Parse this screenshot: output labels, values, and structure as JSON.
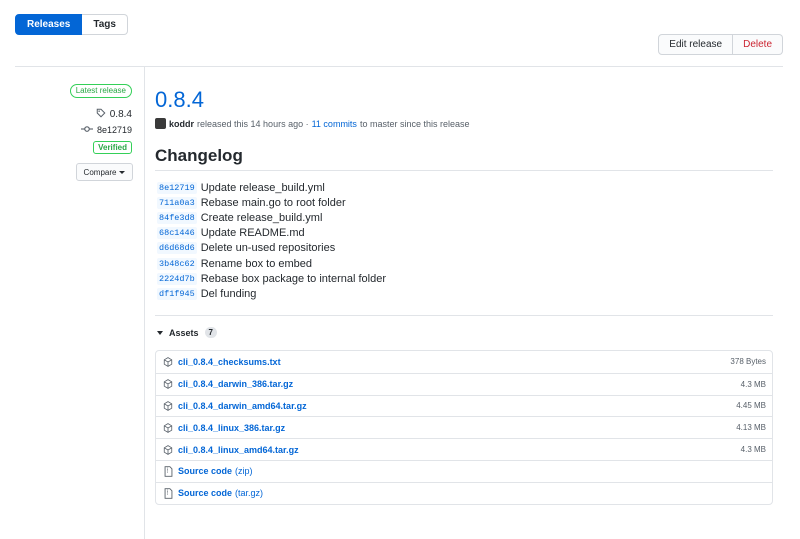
{
  "subnav": {
    "releases": "Releases",
    "tags": "Tags"
  },
  "actions": {
    "edit": "Edit release",
    "delete": "Delete"
  },
  "meta": {
    "latest": "Latest release",
    "tag": "0.8.4",
    "commit": "8e12719",
    "verified": "Verified",
    "compare": "Compare"
  },
  "release": {
    "version": "0.8.4",
    "author": "koddr",
    "released_text": "released this 14 hours ago ·",
    "commits_link": "11 commits",
    "since_text": "to master since this release"
  },
  "changelog": {
    "title": "Changelog",
    "commits": [
      {
        "sha": "8e12719",
        "msg": "Update release_build.yml"
      },
      {
        "sha": "711a0a3",
        "msg": "Rebase main.go to root folder"
      },
      {
        "sha": "84fe3d8",
        "msg": "Create release_build.yml"
      },
      {
        "sha": "68c1446",
        "msg": "Update README.md"
      },
      {
        "sha": "d6d68d6",
        "msg": "Delete un-used repositories"
      },
      {
        "sha": "3b48c62",
        "msg": "Rename box to embed"
      },
      {
        "sha": "2224d7b",
        "msg": "Rebase box package to internal folder"
      },
      {
        "sha": "df1f945",
        "msg": "Del funding"
      }
    ]
  },
  "assets": {
    "title": "Assets",
    "count": "7",
    "files": [
      {
        "name": "cli_0.8.4_checksums.txt",
        "size": "378 Bytes",
        "icon": "package-icon"
      },
      {
        "name": "cli_0.8.4_darwin_386.tar.gz",
        "size": "4.3 MB",
        "icon": "package-icon"
      },
      {
        "name": "cli_0.8.4_darwin_amd64.tar.gz",
        "size": "4.45 MB",
        "icon": "package-icon"
      },
      {
        "name": "cli_0.8.4_linux_386.tar.gz",
        "size": "4.13 MB",
        "icon": "package-icon"
      },
      {
        "name": "cli_0.8.4_linux_amd64.tar.gz",
        "size": "4.3 MB",
        "icon": "package-icon"
      }
    ],
    "source": [
      {
        "name": "Source code",
        "suffix": "(zip)",
        "icon": "file-zip-icon"
      },
      {
        "name": "Source code",
        "suffix": "(tar.gz)",
        "icon": "file-zip-icon"
      }
    ]
  },
  "colors": {
    "link": "#0366d6",
    "green": "#28a745",
    "danger": "#cb2431"
  }
}
